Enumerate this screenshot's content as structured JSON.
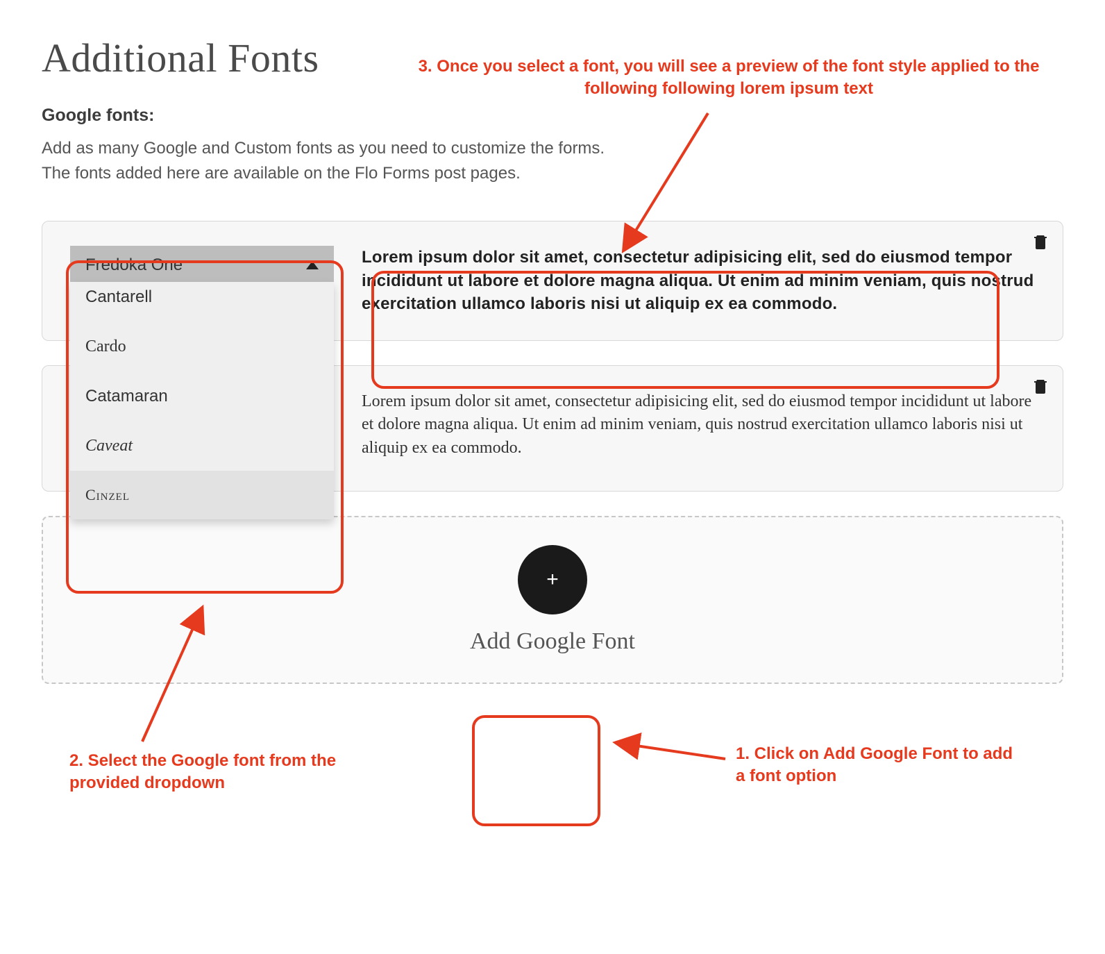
{
  "page": {
    "title": "Additional Fonts",
    "sectionLabel": "Google fonts:",
    "description1": "Add as many Google and Custom fonts as you need to customize the forms.",
    "description2": "The fonts added here are available on the Flo Forms post pages."
  },
  "dropdown": {
    "selected": "Fredoka One",
    "options": {
      "cantarell": "Cantarell",
      "cardo": "Cardo",
      "catamaran": "Catamaran",
      "caveat": "Caveat",
      "cinzel": "Cinzel"
    }
  },
  "cards": {
    "preview1": "Lorem ipsum dolor sit amet, consectetur adipisicing elit, sed do eiusmod tempor incididunt ut labore et dolore magna aliqua. Ut enim ad minim veniam, quis nostrud exercitation ullamco laboris nisi ut aliquip ex ea commodo.",
    "preview2": "Lorem ipsum dolor sit amet, consectetur adipisicing elit, sed do eiusmod tempor incididunt ut labore et dolore magna aliqua. Ut enim ad minim veniam, quis nostrud exercitation ullamco laboris nisi ut aliquip ex ea commodo."
  },
  "addCard": {
    "label": "Add Google Font",
    "plus": "+"
  },
  "annotations": {
    "a1": "1. Click on Add Google Font to add a font option",
    "a2": "2. Select the Google font from the provided dropdown",
    "a3": "3. Once you select a font, you will see a preview of the font style applied to the following following lorem ipsum text"
  },
  "colors": {
    "annotation": "#e63a1f"
  }
}
